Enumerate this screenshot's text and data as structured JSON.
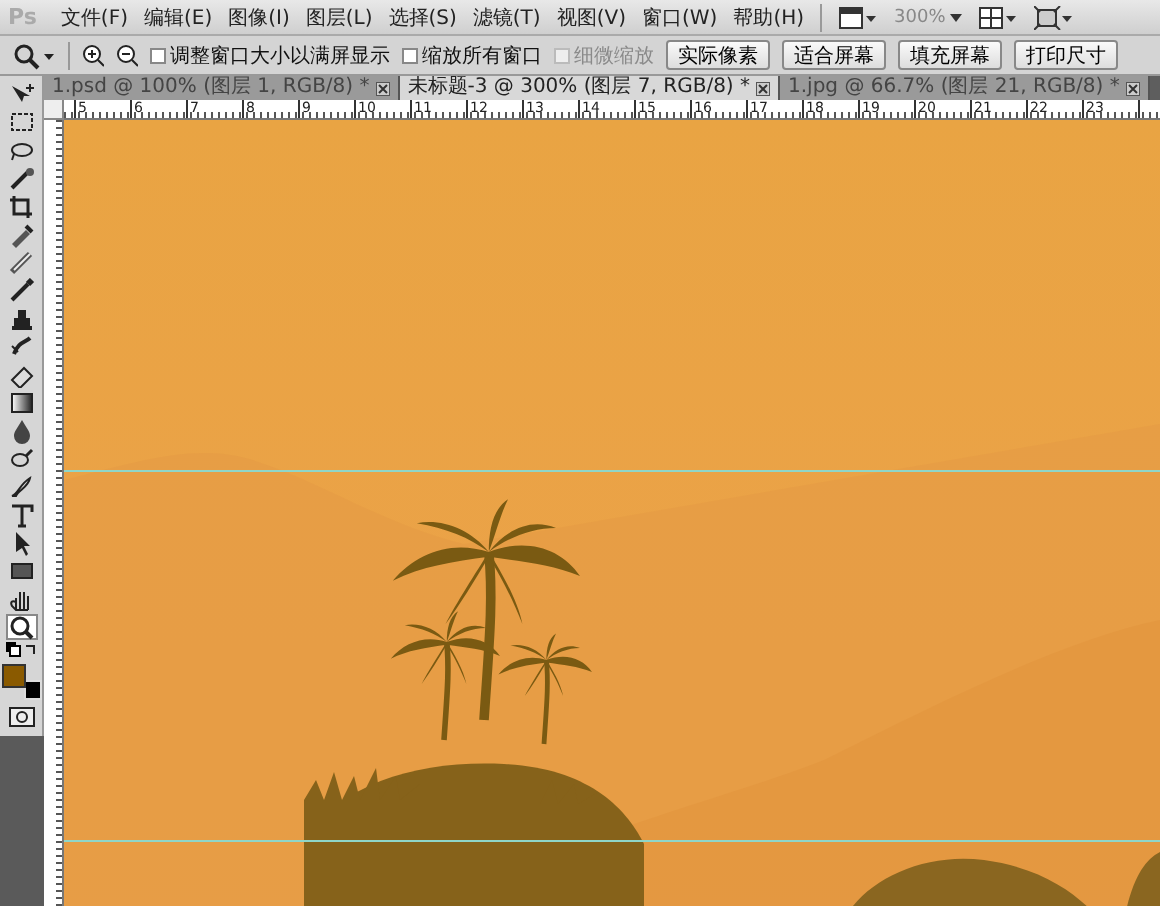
{
  "menu_bar": {
    "logo": "Ps",
    "items": [
      "文件(F)",
      "编辑(E)",
      "图像(I)",
      "图层(L)",
      "选择(S)",
      "滤镜(T)",
      "视图(V)",
      "窗口(W)",
      "帮助(H)"
    ],
    "zoom": "300%"
  },
  "options_bar": {
    "checkboxes": [
      {
        "label": "调整窗口大小以满屏显示",
        "checked": false,
        "disabled": false
      },
      {
        "label": "缩放所有窗口",
        "checked": false,
        "disabled": false
      },
      {
        "label": "细微缩放",
        "checked": false,
        "disabled": true
      }
    ],
    "buttons": [
      "实际像素",
      "适合屏幕",
      "填充屏幕",
      "打印尺寸"
    ]
  },
  "document_tabs": [
    {
      "label": "1.psd @ 100% (图层 1, RGB/8) *",
      "selected": false
    },
    {
      "label": "未标题-3 @ 300% (图层 7, RGB/8) *",
      "selected": true
    },
    {
      "label": "1.jpg @ 66.7% (图层 21, RGB/8) *",
      "selected": false
    }
  ],
  "ruler": {
    "labels": [
      "5",
      "6",
      "7",
      "8",
      "9",
      "10",
      "11",
      "12",
      "13",
      "14",
      "15",
      "16",
      "17",
      "18",
      "19",
      "20",
      "21",
      "22",
      "23"
    ]
  },
  "tools": [
    {
      "selected": false
    },
    {
      "selected": false
    },
    {
      "selected": false
    },
    {
      "selected": false
    },
    {
      "selected": false
    },
    {
      "selected": false
    },
    {
      "selected": false
    },
    {
      "selected": false
    },
    {
      "selected": false
    },
    {
      "selected": false
    },
    {
      "selected": false
    },
    {
      "selected": false
    },
    {
      "selected": false
    },
    {
      "selected": false
    },
    {
      "selected": false
    },
    {
      "selected": false
    },
    {
      "selected": false
    },
    {
      "selected": false
    },
    {
      "selected": false
    },
    {
      "selected": true
    }
  ]
}
